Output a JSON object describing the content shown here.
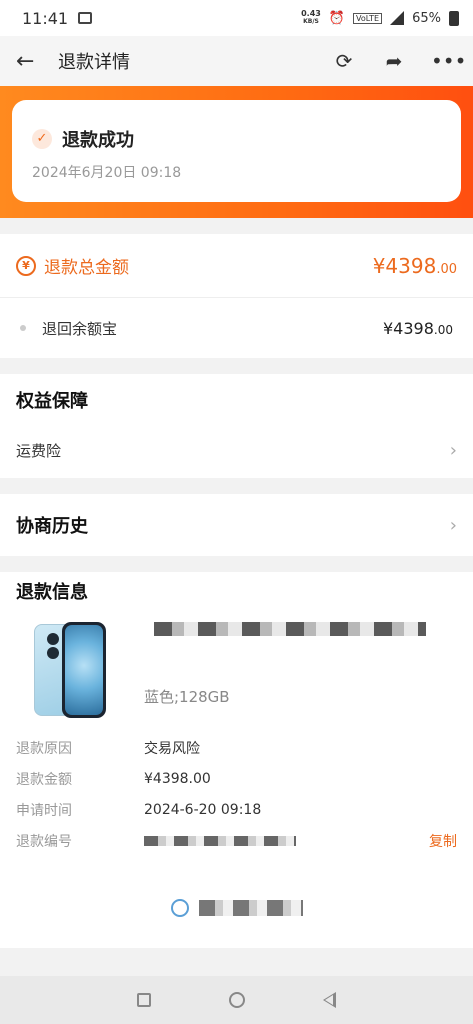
{
  "status_bar": {
    "time": "11:41",
    "net_speed": "0.43",
    "net_unit": "KB/S",
    "volte": "VoLTE",
    "network": "4G",
    "battery": "65%"
  },
  "header": {
    "back_icon": "arrow-left-icon",
    "title": "退款详情",
    "refresh_icon": "refresh-icon",
    "share_icon": "share-icon",
    "more_icon": "more-icon"
  },
  "status_card": {
    "title": "退款成功",
    "datetime": "2024年6月20日 09:18"
  },
  "refund_total": {
    "label": "退款总金额",
    "amount_main": "¥4398",
    "amount_decimal": ".00",
    "sub_label": "退回余额宝",
    "sub_amount_main": "¥4398",
    "sub_amount_decimal": ".00"
  },
  "rights": {
    "title": "权益保障",
    "items": [
      {
        "label": "运费险"
      }
    ]
  },
  "history": {
    "title": "协商历史"
  },
  "refund_info": {
    "title": "退款信息",
    "product_spec": "蓝色;128GB",
    "rows": [
      {
        "key": "退款原因",
        "value": "交易风险"
      },
      {
        "key": "退款金额",
        "value": "¥4398.00"
      },
      {
        "key": "申请时间",
        "value": "2024-6-20 09:18"
      },
      {
        "key": "退款编号",
        "value": ""
      }
    ],
    "copy_label": "复制"
  },
  "colors": {
    "accent": "#ec6a1e",
    "gradient_start": "#ff8a1f",
    "gradient_end": "#ff4f10"
  }
}
